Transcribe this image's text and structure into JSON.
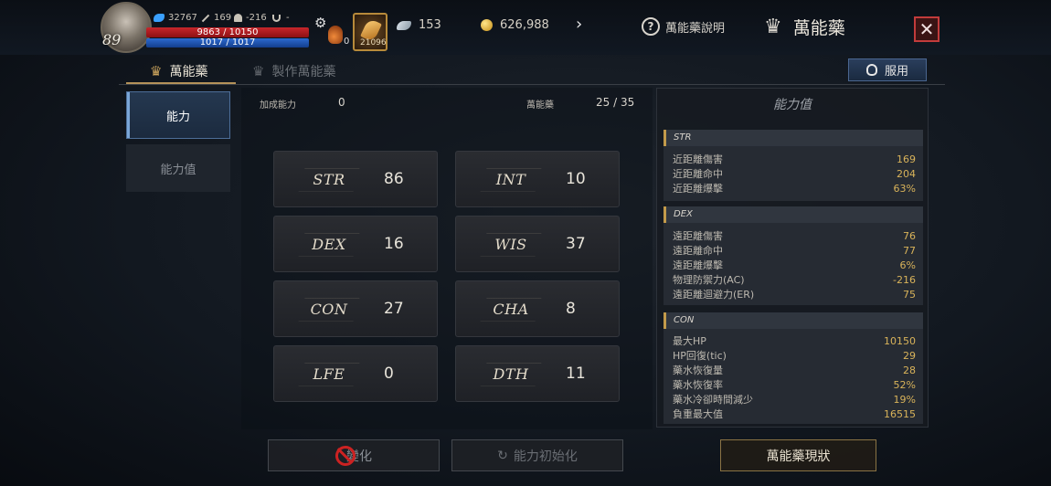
{
  "player": {
    "level": "89",
    "exp": "32767",
    "stat_a": "169",
    "stat_b": "-216",
    "stat_c": "-",
    "hp": "9863 / 10150",
    "mp": "1017 / 1017"
  },
  "quick": {
    "slot1_count": "0",
    "slot2_count": "21096"
  },
  "currencies": {
    "feather": "153",
    "gold": "626,988"
  },
  "header": {
    "help_label": "萬能藥說明",
    "title": "萬能藥",
    "close_label": "✕"
  },
  "tabs": [
    {
      "label": "萬能藥"
    },
    {
      "label": "製作萬能藥"
    }
  ],
  "use_button": "服用",
  "side_menu": [
    {
      "label": "能力"
    },
    {
      "label": "能力值"
    }
  ],
  "summary": {
    "bonus_label": "加成能力",
    "bonus_value": "0",
    "potion_label": "萬能藥",
    "potion_value": "25 / 35"
  },
  "stats": [
    {
      "name": "STR",
      "value": "86"
    },
    {
      "name": "INT",
      "value": "10"
    },
    {
      "name": "DEX",
      "value": "16"
    },
    {
      "name": "WIS",
      "value": "37"
    },
    {
      "name": "CON",
      "value": "27"
    },
    {
      "name": "CHA",
      "value": "8"
    },
    {
      "name": "LFE",
      "value": "0"
    },
    {
      "name": "DTH",
      "value": "11"
    }
  ],
  "ability_panel": {
    "title": "能力值",
    "sections": [
      {
        "name": "STR",
        "rows": [
          {
            "label": "近距離傷害",
            "value": "169"
          },
          {
            "label": "近距離命中",
            "value": "204"
          },
          {
            "label": "近距離爆擊",
            "value": "63%"
          }
        ]
      },
      {
        "name": "DEX",
        "rows": [
          {
            "label": "遠距離傷害",
            "value": "76"
          },
          {
            "label": "遠距離命中",
            "value": "77"
          },
          {
            "label": "遠距離爆擊",
            "value": "6%"
          },
          {
            "label": "物理防禦力(AC)",
            "value": "-216"
          },
          {
            "label": "遠距離迴避力(ER)",
            "value": "75"
          }
        ]
      },
      {
        "name": "CON",
        "rows": [
          {
            "label": "最大HP",
            "value": "10150"
          },
          {
            "label": "HP回復(tic)",
            "value": "29"
          },
          {
            "label": "藥水恢復量",
            "value": "28"
          },
          {
            "label": "藥水恢復率",
            "value": "52%"
          },
          {
            "label": "藥水冷卻時間減少",
            "value": "19%"
          },
          {
            "label": "負重最大值",
            "value": "16515"
          }
        ]
      }
    ]
  },
  "bottom": {
    "btn1": "變化",
    "btn2": "能力初始化",
    "btn3": "萬能藥現狀"
  },
  "colors": {
    "accent_gold": "#d9b35a",
    "close_red": "#c23b3b",
    "hp_red": "#c8262b",
    "mp_blue": "#2c6ad0"
  }
}
